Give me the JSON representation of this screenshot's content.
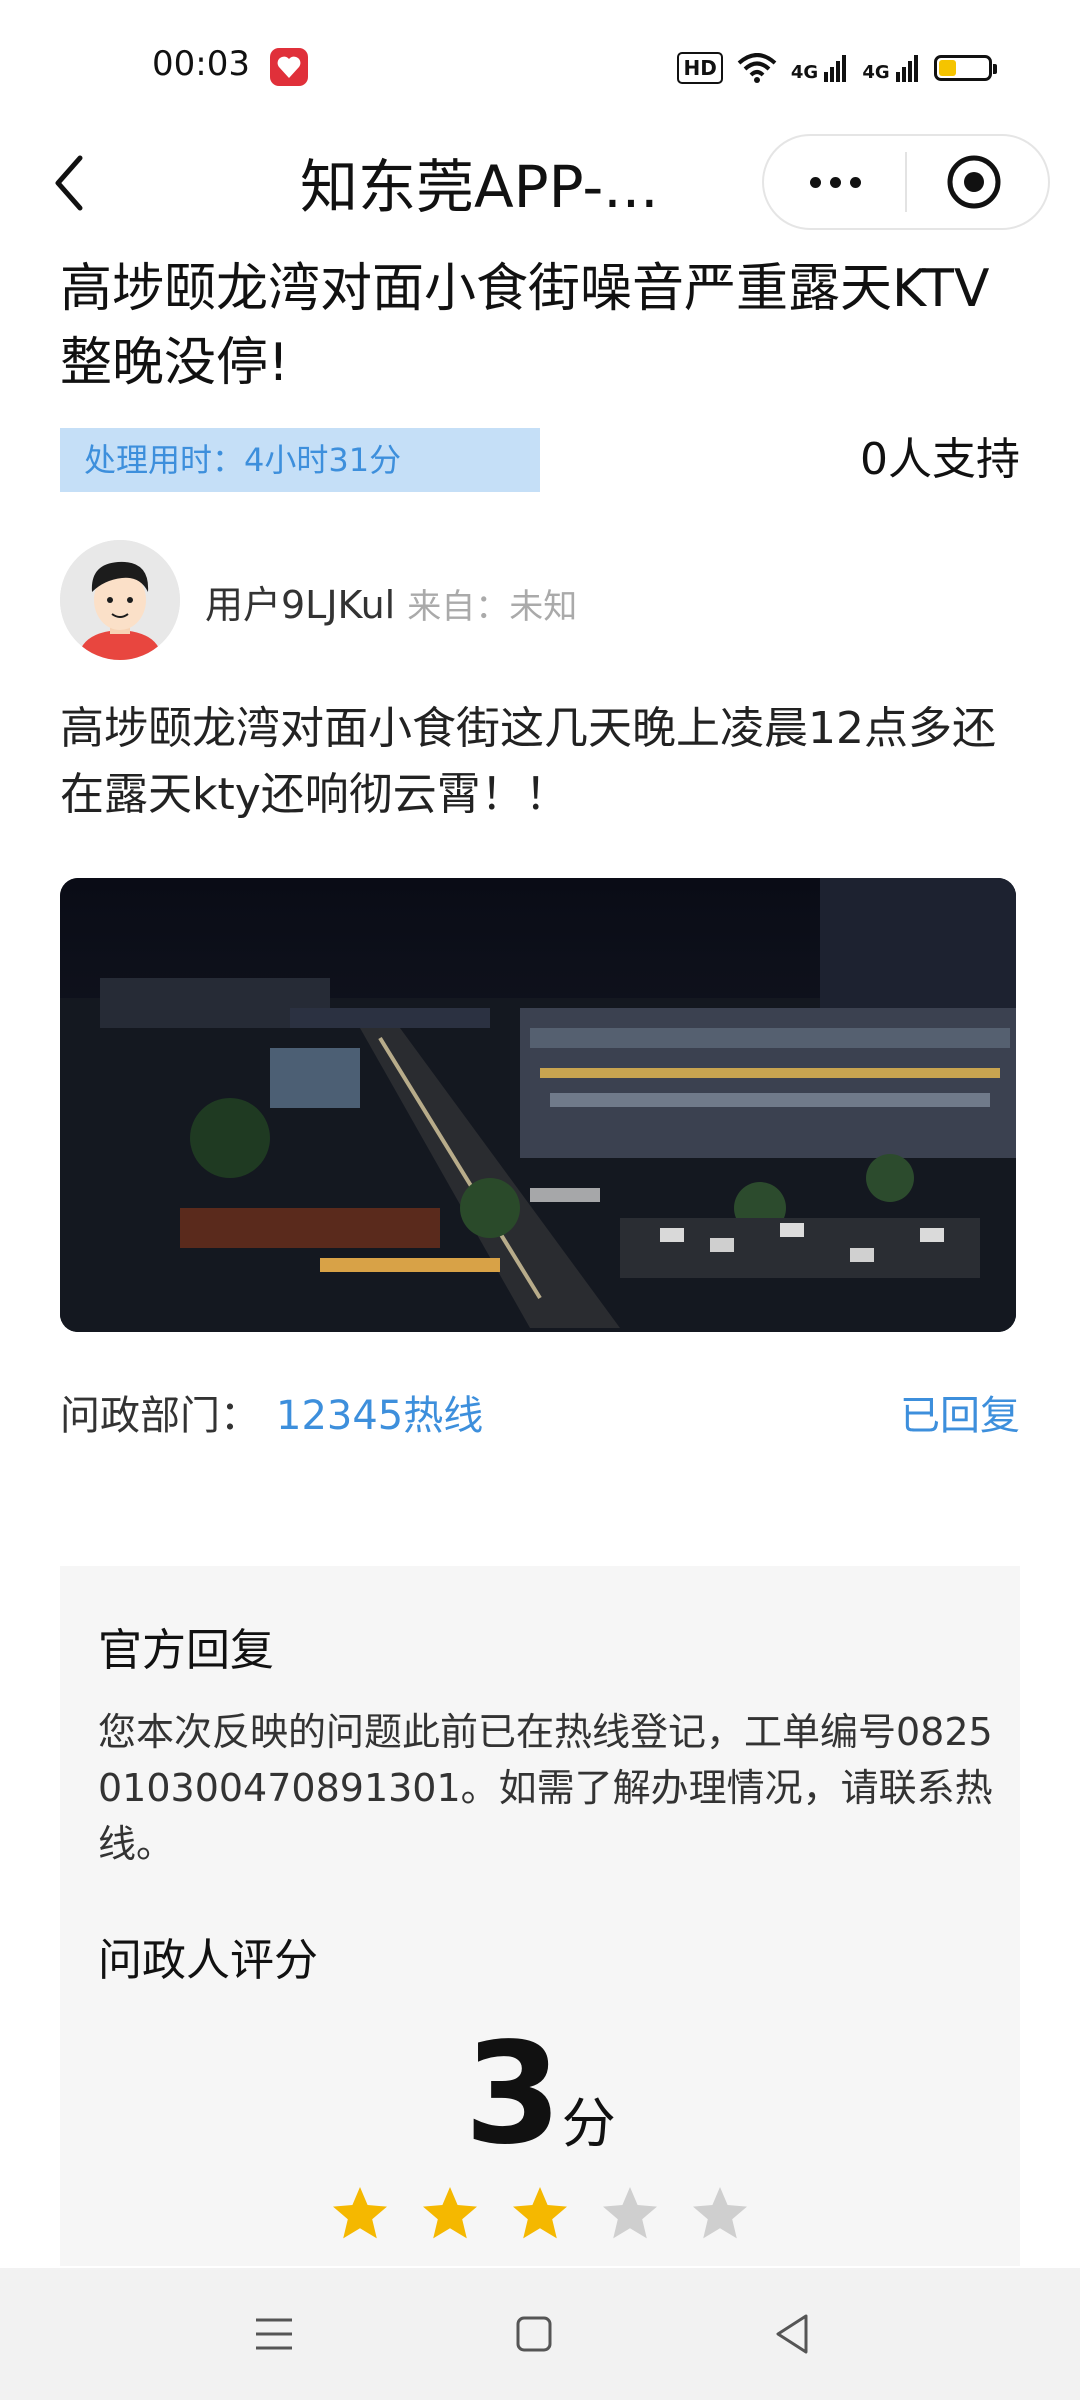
{
  "status_bar": {
    "time": "00:03",
    "hd_label": "HD",
    "signal1_label": "4G",
    "signal2_label": "4G",
    "battery_level": 0.35
  },
  "nav": {
    "title": "知东莞APP-...",
    "more_icon": "more-dots-icon",
    "close_icon": "target-circle-icon"
  },
  "post": {
    "title": "高埗颐龙湾对面小食街噪音严重露天KTV整晚没停!",
    "processing_time": "处理用时：4小时31分",
    "support_count": "0人支持",
    "author_name": "用户9LJKul",
    "author_from": "来自：未知",
    "content": "高埗颐龙湾对面小食街这几天晚上凌晨12点多还在露天kty还响彻云霄！！",
    "department_label": "问政部门：",
    "department_value": "12345热线",
    "reply_status": "已回复"
  },
  "reply": {
    "title": "官方回复",
    "text": "您本次反映的问题此前已在热线登记，工单编号0825010300470891301。如需了解办理情况，请联系热线。",
    "rating_title": "问政人评分",
    "score": "3",
    "score_unit": "分",
    "stars_filled": 3,
    "stars_total": 5,
    "star_color_filled": "#f5b800",
    "star_color_empty": "#cfcfcf"
  },
  "system_nav": {
    "menu_icon": "menu-icon",
    "home_icon": "home-square-icon",
    "back_icon": "back-triangle-icon"
  }
}
